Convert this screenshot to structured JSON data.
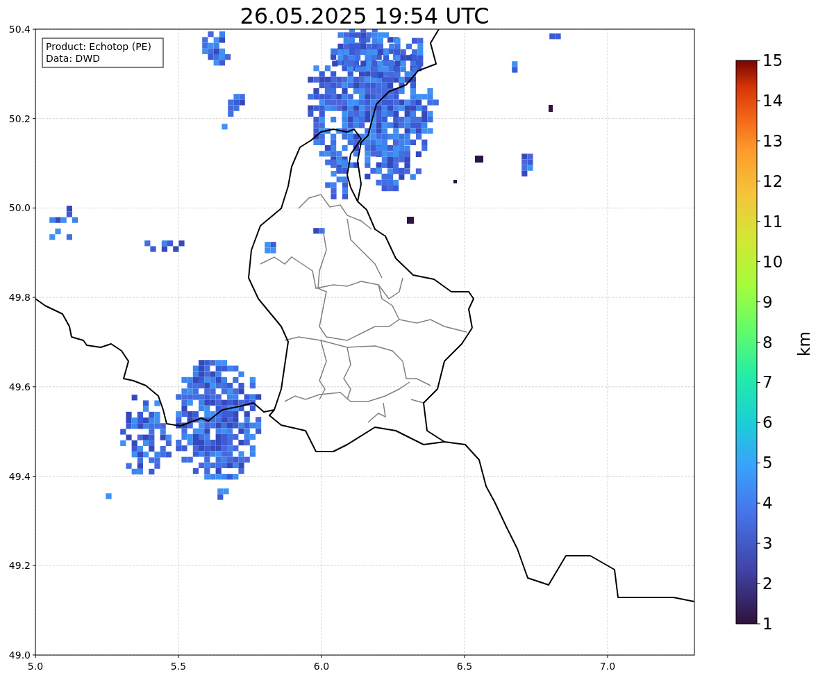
{
  "title": "26.05.2025 19:54 UTC",
  "map": {
    "annotation": [
      "Product: Echotop (PE)",
      "Data: DWD"
    ],
    "x_ticks": [
      "5.0",
      "5.5",
      "6.0",
      "6.5",
      "7.0"
    ],
    "y_ticks": [
      "50.4",
      "50.2",
      "50.0",
      "49.8",
      "49.6",
      "49.4",
      "49.2",
      "49.0"
    ]
  },
  "colorbar": {
    "label": "km",
    "ticks": [
      "15",
      "14",
      "13",
      "12",
      "11",
      "10",
      "9",
      "8",
      "7",
      "6",
      "5",
      "4",
      "3",
      "2",
      "1"
    ]
  }
}
